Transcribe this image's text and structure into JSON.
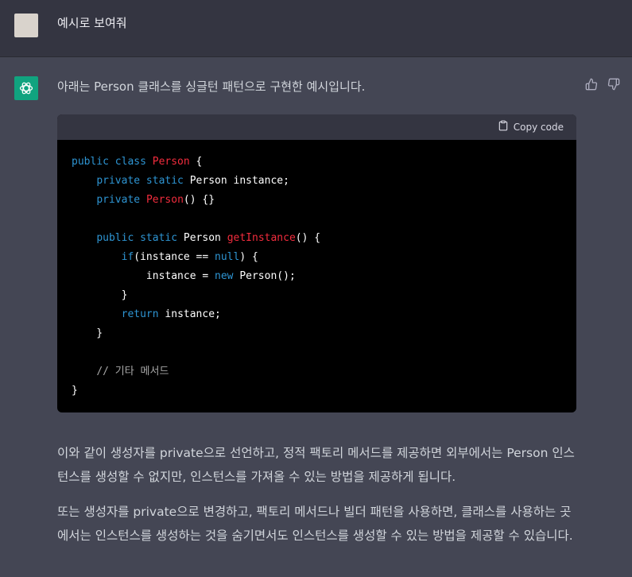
{
  "user_message": "예시로 보여줘",
  "assistant": {
    "intro": "아래는 Person 클래스를 싱글턴 패턴으로 구현한 예시입니다.",
    "copy_label": "Copy code",
    "code_lines": [
      [
        {
          "t": "public class ",
          "c": "kw"
        },
        {
          "t": "Person",
          "c": "cls"
        },
        {
          "t": " {",
          "c": ""
        }
      ],
      [
        {
          "t": "    ",
          "c": ""
        },
        {
          "t": "private static ",
          "c": "kw"
        },
        {
          "t": "Person instance;",
          "c": ""
        }
      ],
      [
        {
          "t": "    ",
          "c": ""
        },
        {
          "t": "private ",
          "c": "kw"
        },
        {
          "t": "Person",
          "c": "fn"
        },
        {
          "t": "() {}",
          "c": ""
        }
      ],
      [
        {
          "t": "",
          "c": ""
        }
      ],
      [
        {
          "t": "    ",
          "c": ""
        },
        {
          "t": "public static ",
          "c": "kw"
        },
        {
          "t": "Person ",
          "c": ""
        },
        {
          "t": "getInstance",
          "c": "fn"
        },
        {
          "t": "() {",
          "c": ""
        }
      ],
      [
        {
          "t": "        ",
          "c": ""
        },
        {
          "t": "if",
          "c": "kw"
        },
        {
          "t": "(instance == ",
          "c": ""
        },
        {
          "t": "null",
          "c": "kw"
        },
        {
          "t": ") {",
          "c": ""
        }
      ],
      [
        {
          "t": "            instance = ",
          "c": ""
        },
        {
          "t": "new ",
          "c": "kw"
        },
        {
          "t": "Person();",
          "c": ""
        }
      ],
      [
        {
          "t": "        }",
          "c": ""
        }
      ],
      [
        {
          "t": "        ",
          "c": ""
        },
        {
          "t": "return ",
          "c": "kw"
        },
        {
          "t": "instance;",
          "c": ""
        }
      ],
      [
        {
          "t": "    }",
          "c": ""
        }
      ],
      [
        {
          "t": "",
          "c": ""
        }
      ],
      [
        {
          "t": "    ",
          "c": ""
        },
        {
          "t": "// 기타 메서드",
          "c": "cm"
        }
      ],
      [
        {
          "t": "}",
          "c": ""
        }
      ]
    ],
    "paragraph1": "이와 같이 생성자를 private으로 선언하고, 정적 팩토리 메서드를 제공하면 외부에서는 Person 인스턴스를 생성할 수 없지만, 인스턴스를 가져올 수 있는 방법을 제공하게 됩니다.",
    "paragraph2": "또는 생성자를 private으로 변경하고, 팩토리 메서드나 빌더 패턴을 사용하면, 클래스를 사용하는 곳에서는 인스턴스를 생성하는 것을 숨기면서도 인스턴스를 생성할 수 있는 방법을 제공할 수 있습니다."
  },
  "icons": {
    "assistant_avatar": "openai-logo-icon",
    "thumb_up": "thumbs-up-icon",
    "thumb_down": "thumbs-down-icon",
    "copy": "clipboard-icon"
  },
  "colors": {
    "accent": "#10a37f",
    "keyword": "#2e95d3",
    "class_name": "#f22c3d"
  }
}
